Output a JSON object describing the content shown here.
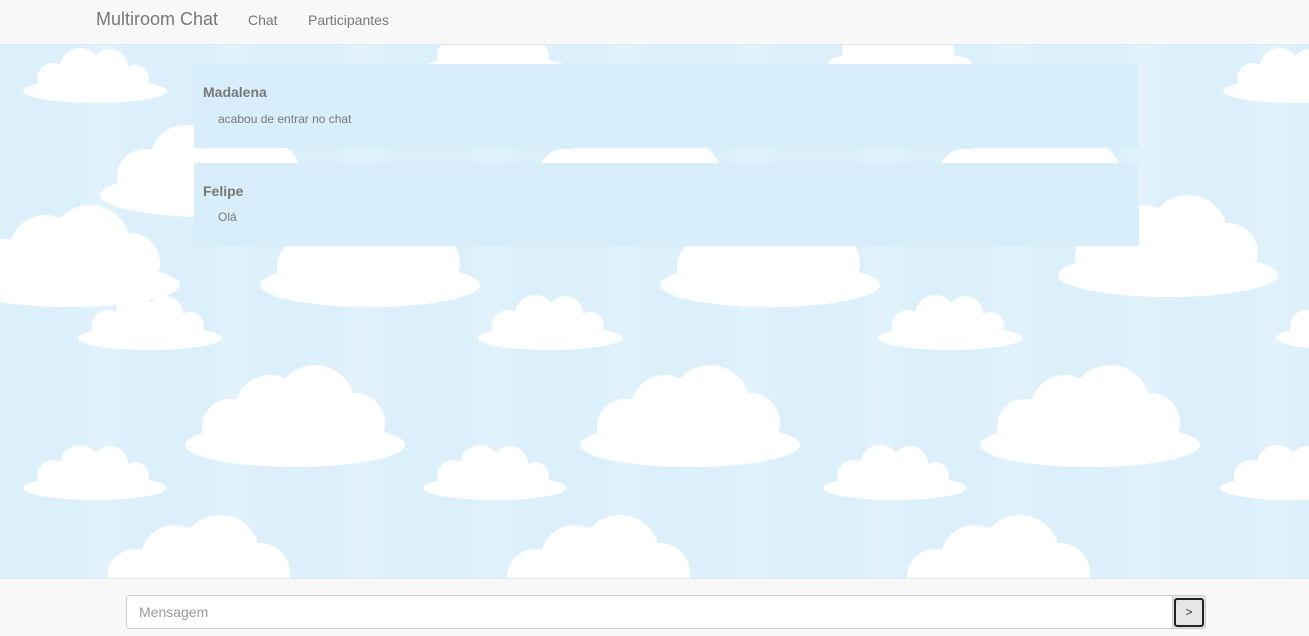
{
  "navbar": {
    "brand": "Multiroom Chat",
    "links": [
      "Chat",
      "Participantes"
    ]
  },
  "messages": [
    {
      "author": "Madalena",
      "text": "acabou de entrar no chat"
    },
    {
      "author": "Felipe",
      "text": "Olá"
    }
  ],
  "composer": {
    "placeholder": "Mensagem",
    "value": "",
    "send_label": ">"
  },
  "colors": {
    "sky": "#dcf0fb",
    "message_bg": "#d8eefb",
    "navbar_bg": "#f8f8f8",
    "text": "#777777"
  }
}
